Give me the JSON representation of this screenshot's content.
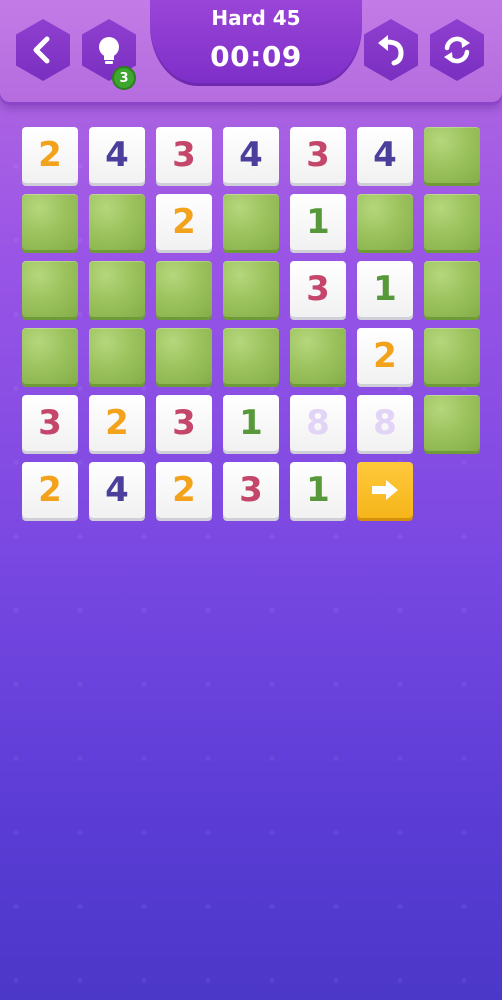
{
  "header": {
    "level_title": "Hard 45",
    "timer": "00:09",
    "hint_count": "3",
    "buttons": {
      "back_icon": "chevron-left",
      "hint_icon": "lightbulb",
      "undo_icon": "undo-arrow",
      "restart_icon": "refresh"
    }
  },
  "colors": {
    "tile_2": "#f2a31b",
    "tile_4": "#4a3f9a",
    "tile_3": "#c4466a",
    "tile_1": "#57993a",
    "tile_8_faded": "#e2d4f6",
    "green_tile": "#9cc35e",
    "arrow_tile": "#f5b51a"
  },
  "board": {
    "rows": [
      [
        "2",
        "4",
        "3",
        "4",
        "3",
        "4",
        "G"
      ],
      [
        "G",
        "G",
        "2",
        "G",
        "1",
        "G",
        "G"
      ],
      [
        "G",
        "G",
        "G",
        "G",
        "3",
        "1",
        "G"
      ],
      [
        "G",
        "G",
        "G",
        "G",
        "G",
        "2",
        "G"
      ],
      [
        "3",
        "2",
        "3",
        "1",
        "8",
        "8",
        "G"
      ],
      [
        "2",
        "4",
        "2",
        "3",
        "1",
        "→"
      ]
    ]
  }
}
